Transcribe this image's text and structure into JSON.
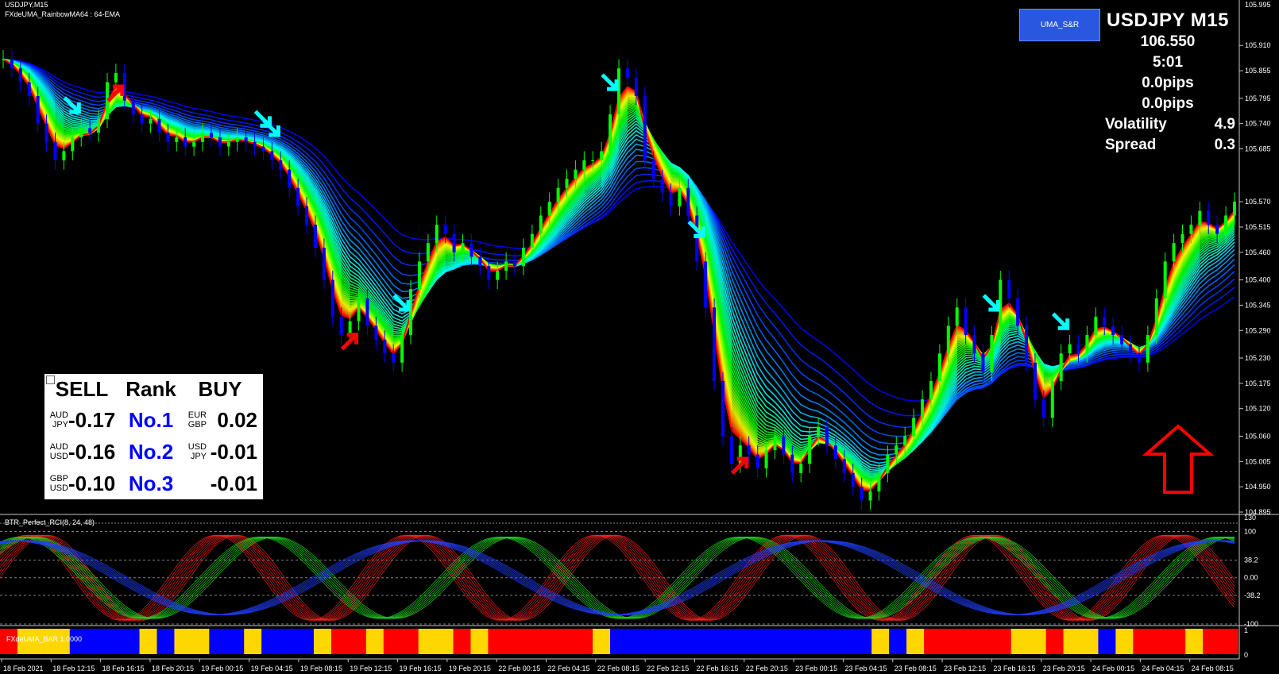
{
  "window": {
    "title": "USDJPY,M15",
    "indicator_label": "FXdeUMA_RainbowMA64 : 64-EMA",
    "rci_label": "BTR_Perfect_RCI(8, 24, 48)",
    "bar_label": "FXdeUMA_BAR 1.0000"
  },
  "button": {
    "label": "UMA_S&R"
  },
  "info": {
    "symbol": "USDJPY M15",
    "price": "106.550",
    "time_left": "5:01",
    "pips1": "0.0pips",
    "pips2": "0.0pips",
    "volatility_label": "Volatility",
    "volatility_value": "4.9",
    "spread_label": "Spread",
    "spread_value": "0.3"
  },
  "rank_table": {
    "headers": {
      "sell": "SELL",
      "rank": "Rank",
      "buy": "BUY"
    },
    "rows": [
      {
        "sell_top": "AUD",
        "sell_bot": "JPY",
        "sell_val": "-0.17",
        "rank": "No.1",
        "buy_top": "EUR",
        "buy_bot": "GBP",
        "buy_val": "0.02"
      },
      {
        "sell_top": "AUD",
        "sell_bot": "USD",
        "sell_val": "-0.16",
        "rank": "No.2",
        "buy_top": "USD",
        "buy_bot": "JPY",
        "buy_val": "-0.01"
      },
      {
        "sell_top": "GBP",
        "sell_bot": "USD",
        "sell_val": "-0.10",
        "rank": "No.3",
        "buy_top": "",
        "buy_bot": "",
        "buy_val": "-0.01"
      }
    ]
  },
  "price_axis": {
    "top_label": "105.995",
    "labels": [
      "105.910",
      "105.855",
      "105.795",
      "105.740",
      "105.685",
      "105.570",
      "105.515",
      "105.460",
      "105.400",
      "105.345",
      "105.290",
      "105.230",
      "105.175",
      "105.120",
      "105.060",
      "105.005",
      "104.950",
      "104.895"
    ],
    "min": 104.895,
    "max": 105.995
  },
  "rci_axis": {
    "labels": [
      "130",
      "100",
      "38.2",
      "0.00",
      "-38.2",
      "-100"
    ]
  },
  "bar_axis": {
    "labels": [
      "1",
      "0"
    ]
  },
  "time_axis": {
    "labels": [
      "18 Feb 2021",
      "18 Feb 12:15",
      "18 Feb 16:15",
      "18 Feb 20:15",
      "19 Feb 00:15",
      "19 Feb 04:15",
      "19 Feb 08:15",
      "19 Feb 12:15",
      "19 Feb 16:15",
      "19 Feb 20:15",
      "22 Feb 00:15",
      "22 Feb 04:15",
      "22 Feb 08:15",
      "22 Feb 12:15",
      "22 Feb 16:15",
      "22 Feb 20:15",
      "23 Feb 00:15",
      "23 Feb 04:15",
      "23 Feb 08:15",
      "23 Feb 12:15",
      "23 Feb 16:15",
      "23 Feb 20:15",
      "24 Feb 00:15",
      "24 Feb 04:15",
      "24 Feb 08:15"
    ]
  },
  "colors": {
    "bull": "#00ff00",
    "bear": "#0000ff",
    "signal_sell": "#00ffff",
    "signal_buy": "#ff0000",
    "bar_blue": "#0000ff",
    "bar_red": "#ff0000",
    "bar_yellow": "#ffd700"
  },
  "chart_data": {
    "type": "line",
    "title": "USDJPY,M15",
    "price_series": [
      105.88,
      105.86,
      105.83,
      105.8,
      105.74,
      105.7,
      105.66,
      105.68,
      105.71,
      105.73,
      105.72,
      105.75,
      105.83,
      105.85,
      105.79,
      105.76,
      105.74,
      105.75,
      105.72,
      105.7,
      105.71,
      105.69,
      105.7,
      105.72,
      105.71,
      105.69,
      105.7,
      105.71,
      105.7,
      105.69,
      105.68,
      105.66,
      105.64,
      105.6,
      105.56,
      105.52,
      105.47,
      105.4,
      105.32,
      105.28,
      105.31,
      105.36,
      105.3,
      105.27,
      105.24,
      105.22,
      105.28,
      105.38,
      105.44,
      105.48,
      105.52,
      105.5,
      105.46,
      105.48,
      105.45,
      105.43,
      105.4,
      105.42,
      105.44,
      105.43,
      105.47,
      105.5,
      105.54,
      105.57,
      105.6,
      105.62,
      105.64,
      105.66,
      105.66,
      105.68,
      105.76,
      105.86,
      105.84,
      105.8,
      105.66,
      105.62,
      105.59,
      105.56,
      105.6,
      105.54,
      105.44,
      105.34,
      105.18,
      105.06,
      105.0,
      105.04,
      105.02,
      104.99,
      105.03,
      105.06,
      105.02,
      104.98,
      105.0,
      105.06,
      105.08,
      105.04,
      105.01,
      104.98,
      104.95,
      104.92,
      104.94,
      104.98,
      105.02,
      105.04,
      105.06,
      105.1,
      105.14,
      105.18,
      105.24,
      105.3,
      105.34,
      105.28,
      105.24,
      105.2,
      105.28,
      105.4,
      105.36,
      105.3,
      105.22,
      105.14,
      105.1,
      105.18,
      105.24,
      105.26,
      105.24,
      105.28,
      105.32,
      105.3,
      105.28,
      105.26,
      105.24,
      105.22,
      105.28,
      105.36,
      105.44,
      105.48,
      105.5,
      105.52,
      105.55,
      105.52,
      105.5,
      105.54,
      105.57
    ],
    "bar_sequence": [
      "R",
      "Y",
      "Y",
      "Y",
      "B",
      "B",
      "B",
      "B",
      "Y",
      "B",
      "Y",
      "Y",
      "B",
      "B",
      "Y",
      "B",
      "B",
      "B",
      "Y",
      "R",
      "R",
      "Y",
      "R",
      "R",
      "Y",
      "Y",
      "R",
      "Y",
      "R",
      "R",
      "R",
      "R",
      "R",
      "R",
      "Y",
      "B",
      "B",
      "B",
      "B",
      "B",
      "B",
      "B",
      "B",
      "B",
      "B",
      "B",
      "B",
      "B",
      "B",
      "B",
      "Y",
      "B",
      "Y",
      "R",
      "R",
      "R",
      "R",
      "R",
      "Y",
      "Y",
      "R",
      "Y",
      "Y",
      "B",
      "Y",
      "R",
      "R",
      "R",
      "Y",
      "R",
      "R"
    ]
  }
}
